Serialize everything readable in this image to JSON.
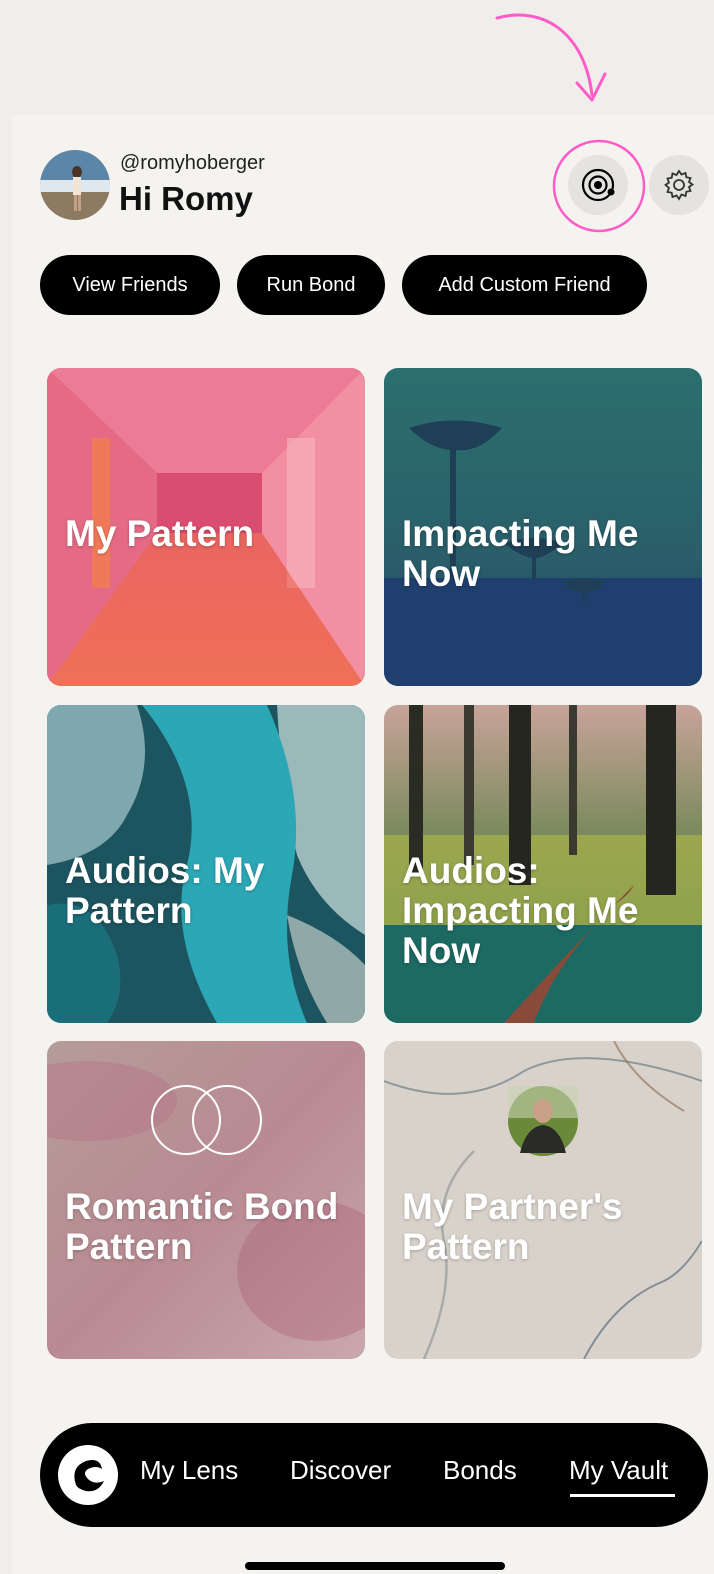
{
  "header": {
    "handle": "@romyhoberger",
    "greeting": "Hi Romy"
  },
  "actions": [
    {
      "label": "View Friends"
    },
    {
      "label": "Run Bond"
    },
    {
      "label": "Add Custom Friend"
    }
  ],
  "tiles": [
    {
      "label": "My Pattern"
    },
    {
      "label": "Impacting Me Now"
    },
    {
      "label": "Audios: My Pattern"
    },
    {
      "label": "Audios: Impacting Me Now"
    },
    {
      "label": "Romantic Bond Pattern"
    },
    {
      "label": "My Partner's Pattern"
    }
  ],
  "nav": {
    "items": [
      {
        "label": "My Lens"
      },
      {
        "label": "Discover"
      },
      {
        "label": "Bonds"
      },
      {
        "label": "My Vault"
      }
    ],
    "active": "My Vault"
  },
  "icons": [
    "orbit-icon",
    "gear-icon",
    "overlapping-rings-icon",
    "app-logo-icon"
  ],
  "colors": {
    "annotation": "#ff5cc8",
    "pill": "#000000",
    "background": "#f4f3ef"
  }
}
